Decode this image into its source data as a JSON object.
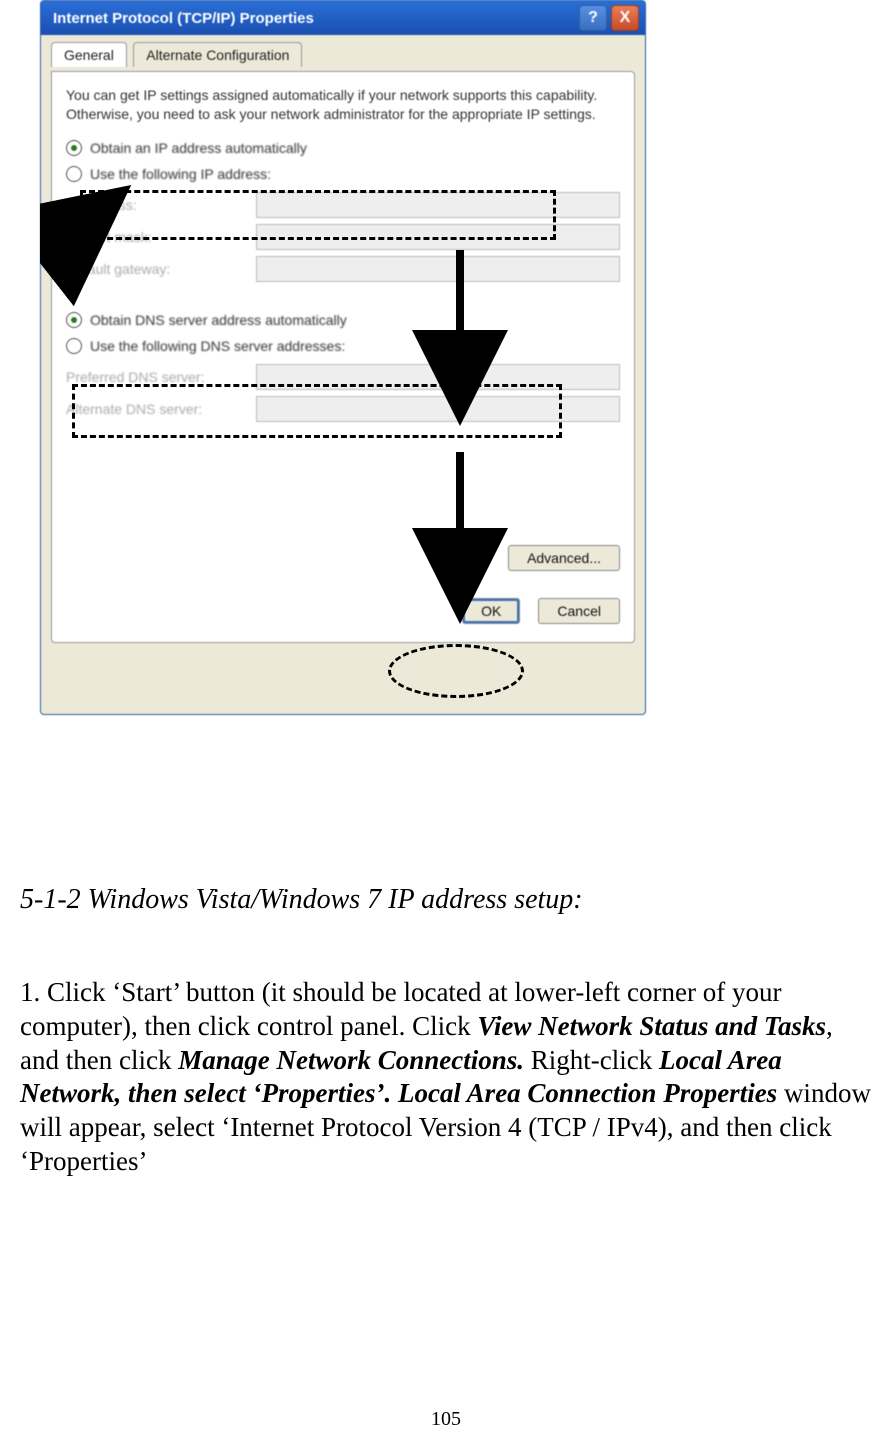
{
  "dialog": {
    "title": "Internet Protocol (TCP/IP) Properties",
    "help_glyph": "?",
    "close_glyph": "X",
    "tabs": {
      "general": "General",
      "alternate": "Alternate Configuration"
    },
    "intro": "You can get IP settings assigned automatically if your network supports this capability. Otherwise, you need to ask your network administrator for the appropriate IP settings.",
    "ip": {
      "auto": "Obtain an IP address automatically",
      "manual": "Use the following IP address:",
      "fields": {
        "ip_addr": "IP address:",
        "subnet": "Subnet mask:",
        "gateway": "Default gateway:"
      }
    },
    "dns": {
      "auto": "Obtain DNS server address automatically",
      "manual": "Use the following DNS server addresses:",
      "fields": {
        "preferred": "Preferred DNS server:",
        "alternate": "Alternate DNS server:"
      }
    },
    "buttons": {
      "advanced": "Advanced...",
      "ok": "OK",
      "cancel": "Cancel"
    }
  },
  "doc": {
    "section_heading": "5-1-2 Windows Vista/Windows 7 IP address setup:",
    "step_prefix": "1. Click ‘Start’ button (it should be located at lower-left corner of your computer), then click control panel. Click ",
    "bold1": "View Network Status and Tasks",
    "mid1": ", and then click ",
    "bold2": "Manage Network Connections.",
    "mid2": " Right-click ",
    "bold3": "Local Area Network, then select ‘Properties’. Local Area Connection Properties",
    "tail": " window will appear, select ‘Internet Protocol Version 4 (TCP / IPv4), and then click ‘Properties’",
    "page_number": "105"
  }
}
